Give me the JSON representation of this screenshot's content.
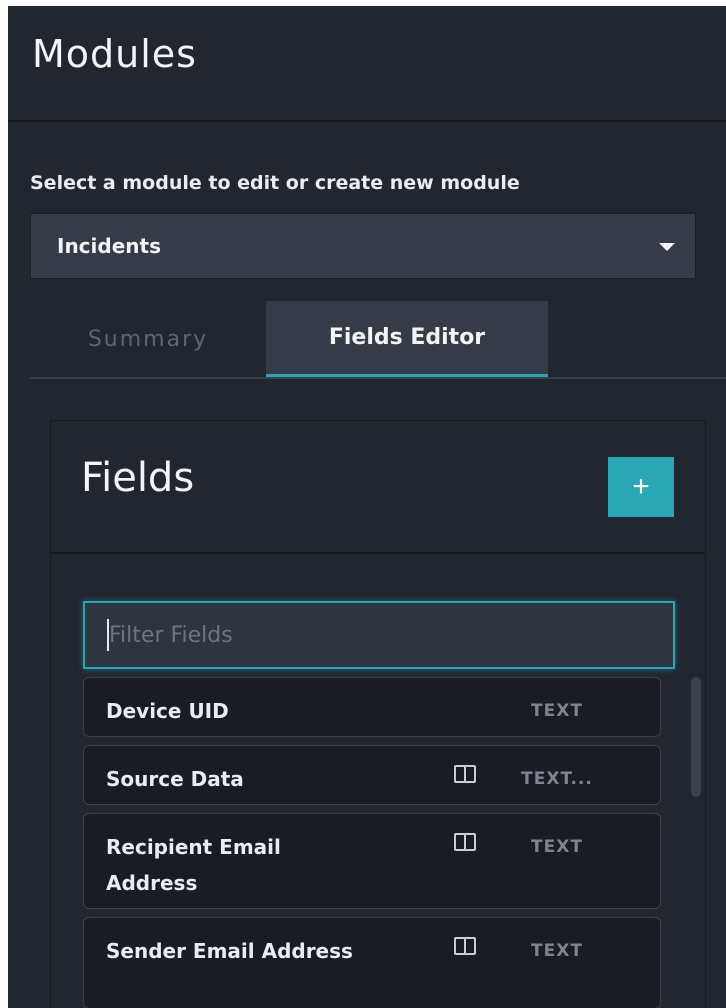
{
  "app": {
    "title": "Modules",
    "select_label": "Select a module to edit or create new module",
    "selected_module": "Incidents"
  },
  "tabs": [
    {
      "label": "Summary",
      "active": false
    },
    {
      "label": "Fields Editor",
      "active": true
    }
  ],
  "fields_panel": {
    "title": "Fields",
    "add_button_label": "+",
    "filter_placeholder": "Filter Fields",
    "filter_value": "",
    "fields": [
      {
        "name": "Device UID",
        "type": "TEXT",
        "layout_icon": false
      },
      {
        "name": "Source Data",
        "type": "TEXT...",
        "layout_icon": true
      },
      {
        "name": "Recipient Email Address",
        "type": "TEXT",
        "layout_icon": true
      },
      {
        "name": "Sender Email Address",
        "type": "TEXT",
        "layout_icon": true
      }
    ]
  },
  "colors": {
    "background": "#22262e",
    "accent": "#26a7b7",
    "input_bg": "#353b47",
    "row_bg": "#191c22"
  },
  "icons": {
    "dropdown": "chevron-down-icon",
    "add": "plus-icon",
    "layout": "layout-icon"
  }
}
